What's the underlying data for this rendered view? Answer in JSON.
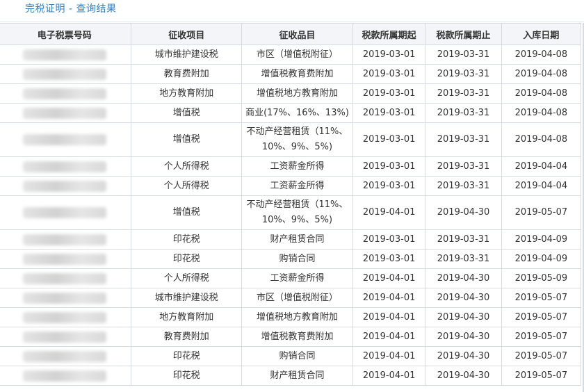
{
  "page": {
    "title": "完税证明 - 查询结果"
  },
  "table": {
    "headers": [
      "电子税票号码",
      "征收项目",
      "征收品目",
      "税款所属期起",
      "税款所属期止",
      "入库日期"
    ],
    "rows": [
      {
        "item": "城市维护建设税",
        "subitem": "市区（增值税附征）",
        "start": "2019-03-01",
        "end": "2019-03-31",
        "date": "2019-04-08"
      },
      {
        "item": "教育费附加",
        "subitem": "增值税教育费附加",
        "start": "2019-03-01",
        "end": "2019-03-31",
        "date": "2019-04-08"
      },
      {
        "item": "地方教育附加",
        "subitem": "增值税地方教育附加",
        "start": "2019-03-01",
        "end": "2019-03-31",
        "date": "2019-04-08"
      },
      {
        "item": "增值税",
        "subitem": "商业(17%、16%、13%)",
        "start": "2019-03-01",
        "end": "2019-03-31",
        "date": "2019-04-08"
      },
      {
        "item": "增值税",
        "subitem": "不动产经营租赁（11%、10%、9%、5%)",
        "start": "2019-03-01",
        "end": "2019-03-31",
        "date": "2019-04-08"
      },
      {
        "item": "个人所得税",
        "subitem": "工资薪金所得",
        "start": "2019-03-01",
        "end": "2019-03-31",
        "date": "2019-04-04"
      },
      {
        "item": "个人所得税",
        "subitem": "工资薪金所得",
        "start": "2019-03-01",
        "end": "2019-03-31",
        "date": "2019-04-04"
      },
      {
        "item": "增值税",
        "subitem": "不动产经营租赁（11%、10%、9%、5%)",
        "start": "2019-04-01",
        "end": "2019-04-30",
        "date": "2019-05-07"
      },
      {
        "item": "印花税",
        "subitem": "财产租赁合同",
        "start": "2019-03-01",
        "end": "2019-03-31",
        "date": "2019-04-09"
      },
      {
        "item": "印花税",
        "subitem": "购销合同",
        "start": "2019-03-01",
        "end": "2019-03-31",
        "date": "2019-04-09"
      },
      {
        "item": "个人所得税",
        "subitem": "工资薪金所得",
        "start": "2019-04-01",
        "end": "2019-04-30",
        "date": "2019-05-09"
      },
      {
        "item": "城市维护建设税",
        "subitem": "市区（增值税附征）",
        "start": "2019-04-01",
        "end": "2019-04-30",
        "date": "2019-05-07"
      },
      {
        "item": "地方教育附加",
        "subitem": "增值税地方教育附加",
        "start": "2019-04-01",
        "end": "2019-04-30",
        "date": "2019-05-07"
      },
      {
        "item": "教育费附加",
        "subitem": "增值税教育费附加",
        "start": "2019-04-01",
        "end": "2019-04-30",
        "date": "2019-05-07"
      },
      {
        "item": "印花税",
        "subitem": "购销合同",
        "start": "2019-04-01",
        "end": "2019-04-30",
        "date": "2019-05-07"
      },
      {
        "item": "印花税",
        "subitem": "财产租赁合同",
        "start": "2019-04-01",
        "end": "2019-04-30",
        "date": "2019-05-07"
      }
    ]
  }
}
